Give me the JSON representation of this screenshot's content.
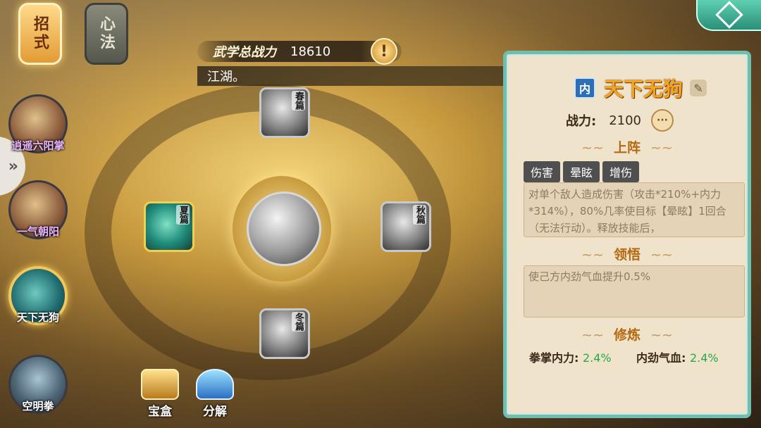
{
  "tabs": [
    {
      "label": "招式",
      "active": true
    },
    {
      "label": "心法",
      "active": false
    }
  ],
  "header": {
    "power_label": "武学总战力",
    "power_value": "18610",
    "marquee": "江湖。"
  },
  "skills": [
    {
      "label": "逍遥六阳掌",
      "style": "purple"
    },
    {
      "label": "一气朝阳",
      "style": "purple"
    },
    {
      "label": "天下无狗",
      "style": "white",
      "active": true
    },
    {
      "label": "空明拳",
      "style": "white"
    }
  ],
  "chapters": {
    "top": "春篇",
    "left": "夏篇",
    "right": "秋篇",
    "bottom": "冬篇"
  },
  "bottom_buttons": {
    "box": "宝盒",
    "decompose": "分解"
  },
  "panel": {
    "type_badge": "内",
    "title": "天下无狗",
    "power_label": "战力:",
    "power_value": "2100",
    "more_icon": "···",
    "section_equip": "上阵",
    "tags": [
      "伤害",
      "晕眩",
      "增伤"
    ],
    "description": "对单个敌人造成伤害（攻击*210%+内力*314%），80%几率使目标【晕眩】1回合（无法行动）。释放技能后，",
    "section_insight": "领悟",
    "insight_text": "使己方内劲气血提升0.5%",
    "section_train": "修炼",
    "train": [
      {
        "label": "拳掌内力:",
        "value": "2.4%"
      },
      {
        "label": "内劲气血:",
        "value": "2.4%"
      }
    ]
  },
  "colors": {
    "accent_teal": "#6fbeb0",
    "title_orange": "#f6a41e",
    "percent_green": "#2aa84a"
  }
}
